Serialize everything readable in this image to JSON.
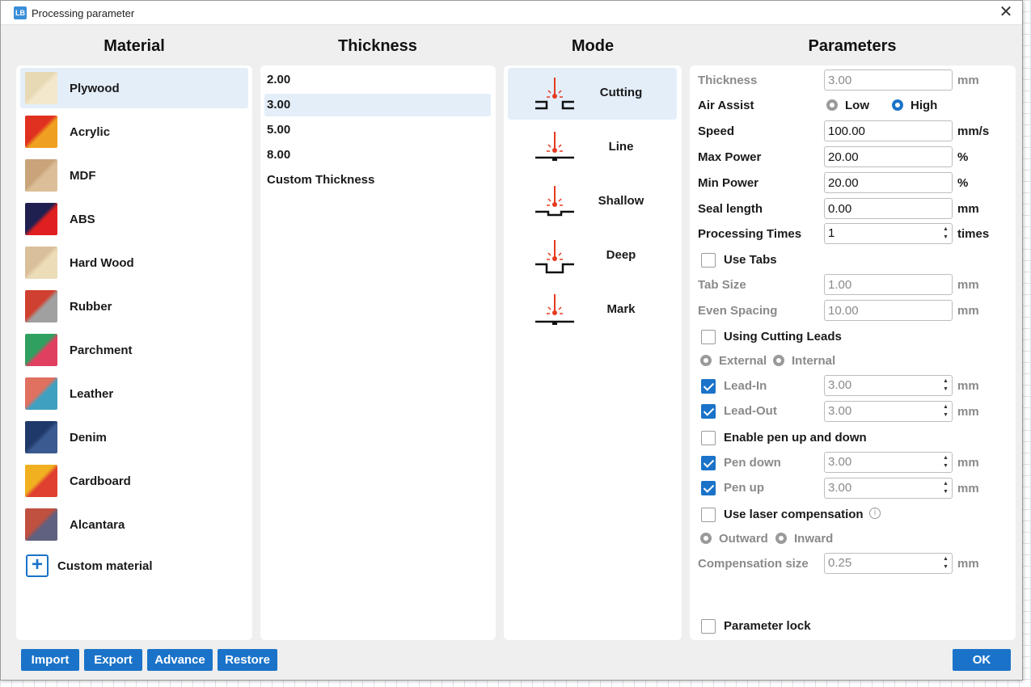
{
  "window": {
    "title": "Processing parameter"
  },
  "columns": {
    "material": "Material",
    "thickness": "Thickness",
    "mode": "Mode",
    "parameters": "Parameters"
  },
  "materials": [
    {
      "label": "Plywood",
      "selected": true,
      "colors": [
        "#e8d9b5",
        "#f3e8cc"
      ]
    },
    {
      "label": "Acrylic",
      "selected": false,
      "colors": [
        "#e03020",
        "#f0a020"
      ]
    },
    {
      "label": "MDF",
      "selected": false,
      "colors": [
        "#c9a47a",
        "#dcbf98"
      ]
    },
    {
      "label": "ABS",
      "selected": false,
      "colors": [
        "#202050",
        "#e02020"
      ]
    },
    {
      "label": "Hard Wood",
      "selected": false,
      "colors": [
        "#d9c09a",
        "#ecdcb8"
      ]
    },
    {
      "label": "Rubber",
      "selected": false,
      "colors": [
        "#d04030",
        "#a0a0a0"
      ]
    },
    {
      "label": "Parchment",
      "selected": false,
      "colors": [
        "#30a060",
        "#e04060"
      ]
    },
    {
      "label": "Leather",
      "selected": false,
      "colors": [
        "#e07060",
        "#40a0c0"
      ]
    },
    {
      "label": "Denim",
      "selected": false,
      "colors": [
        "#1f3a6a",
        "#3a5a90"
      ]
    },
    {
      "label": "Cardboard",
      "selected": false,
      "colors": [
        "#f0b020",
        "#e04030"
      ]
    },
    {
      "label": "Alcantara",
      "selected": false,
      "colors": [
        "#c05040",
        "#606080"
      ]
    }
  ],
  "custom_material": "Custom material",
  "thicknesses": [
    {
      "label": "2.00",
      "selected": false
    },
    {
      "label": "3.00",
      "selected": true
    },
    {
      "label": "5.00",
      "selected": false
    },
    {
      "label": "8.00",
      "selected": false
    },
    {
      "label": "Custom Thickness",
      "selected": false
    }
  ],
  "modes": [
    {
      "label": "Cutting",
      "selected": true,
      "icon": "cutting-icon"
    },
    {
      "label": "Line",
      "selected": false,
      "icon": "line-icon"
    },
    {
      "label": "Shallow",
      "selected": false,
      "icon": "shallow-icon"
    },
    {
      "label": "Deep",
      "selected": false,
      "icon": "deep-icon"
    },
    {
      "label": "Mark",
      "selected": false,
      "icon": "mark-icon"
    }
  ],
  "params": {
    "thickness": {
      "label": "Thickness",
      "value": "3.00",
      "unit": "mm"
    },
    "air_assist": {
      "label": "Air Assist",
      "low": "Low",
      "high": "High",
      "selected": "High"
    },
    "speed": {
      "label": "Speed",
      "value": "100.00",
      "unit": "mm/s"
    },
    "max_power": {
      "label": "Max Power",
      "value": "20.00",
      "unit": "%"
    },
    "min_power": {
      "label": "Min Power",
      "value": "20.00",
      "unit": "%"
    },
    "seal_length": {
      "label": "Seal length",
      "value": "0.00",
      "unit": "mm"
    },
    "processing_times": {
      "label": "Processing Times",
      "value": "1",
      "unit": "times"
    },
    "use_tabs": {
      "label": "Use Tabs",
      "checked": false
    },
    "tab_size": {
      "label": "Tab Size",
      "value": "1.00",
      "unit": "mm"
    },
    "even_spacing": {
      "label": "Even Spacing",
      "value": "10.00",
      "unit": "mm"
    },
    "cutting_leads": {
      "label": "Using Cutting Leads",
      "checked": false
    },
    "lead_side": {
      "external": "External",
      "internal": "Internal"
    },
    "lead_in": {
      "label": "Lead-In",
      "value": "3.00",
      "unit": "mm",
      "checked": true
    },
    "lead_out": {
      "label": "Lead-Out",
      "value": "3.00",
      "unit": "mm",
      "checked": true
    },
    "pen_updown": {
      "label": "Enable pen up and down",
      "checked": false
    },
    "pen_down": {
      "label": "Pen down",
      "value": "3.00",
      "unit": "mm",
      "checked": true
    },
    "pen_up": {
      "label": "Pen up",
      "value": "3.00",
      "unit": "mm",
      "checked": true
    },
    "laser_comp": {
      "label": "Use laser compensation",
      "checked": false
    },
    "comp_side": {
      "outward": "Outward",
      "inward": "Inward"
    },
    "comp_size": {
      "label": "Compensation size",
      "value": "0.25",
      "unit": "mm"
    },
    "param_lock": {
      "label": "Parameter lock",
      "checked": false
    }
  },
  "buttons": {
    "import": "Import",
    "export": "Export",
    "advance": "Advance",
    "restore": "Restore",
    "ok": "OK"
  },
  "colors": {
    "accent": "#1a73c8",
    "selection": "#e3eef9",
    "laser": "#e53a1e"
  }
}
